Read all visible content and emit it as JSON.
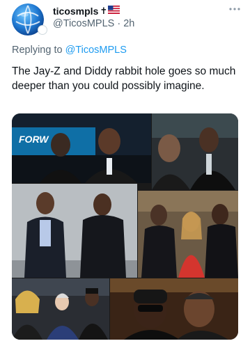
{
  "tweet": {
    "display_name": "ticosmpls",
    "name_symbol": "✝",
    "handle": "@TicosMPLS",
    "separator": "·",
    "time": "2h",
    "more_icon": "more-icon",
    "replying_prefix": "Replying to",
    "replying_to": "@TicosMPLS",
    "text": "The Jay-Z and Diddy rabbit hole goes so much deeper than you could possibly imagine.",
    "media": {
      "photos": [
        {
          "label": "FORW",
          "icon": "photo-stage"
        },
        {
          "icon": "photo-event"
        },
        {
          "icon": "photo-gray-backdrop"
        },
        {
          "icon": "photo-reception"
        },
        {
          "icon": "photo-group"
        },
        {
          "icon": "photo-closeup"
        }
      ]
    },
    "colors": {
      "link": "#1d9bf0",
      "muted": "#536471",
      "text": "#0f1419"
    }
  }
}
